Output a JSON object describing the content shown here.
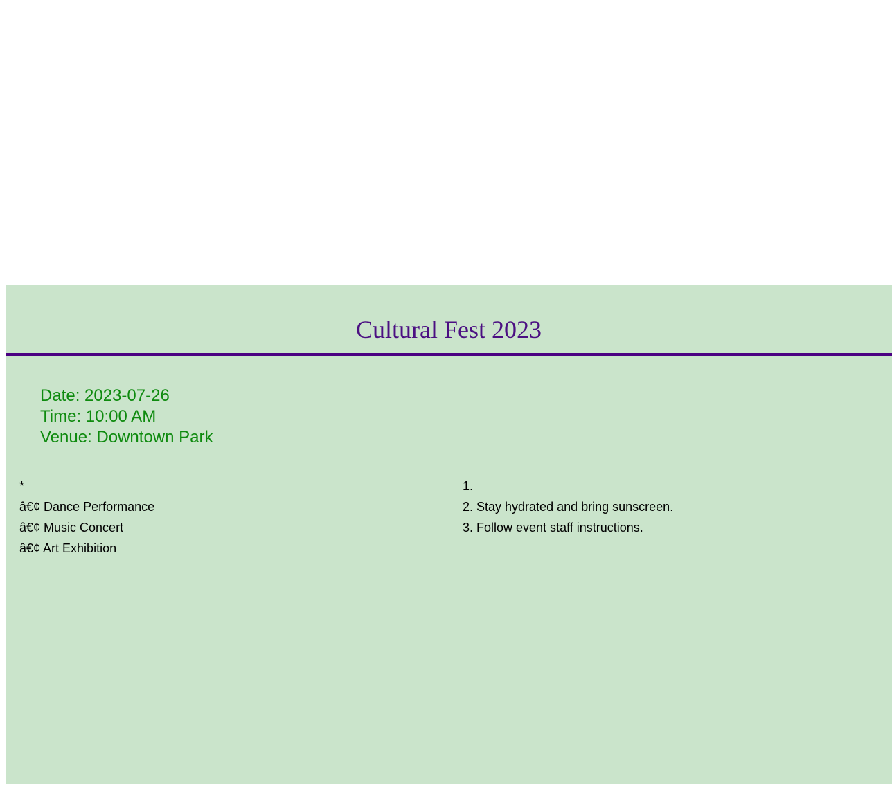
{
  "event": {
    "title": "Cultural Fest 2023",
    "date": "Date: 2023-07-26",
    "time": "Time: 10:00 AM",
    "venue": "Venue: Downtown Park"
  },
  "activities": {
    "marker": "*",
    "items": [
      "â€¢ Dance Performance",
      "â€¢ Music Concert",
      "â€¢ Art Exhibition"
    ]
  },
  "guidelines": {
    "items": [
      "1.",
      "2. Stay hydrated and bring sunscreen.",
      "3. Follow event staff instructions."
    ]
  },
  "colors": {
    "panel_background": "#cae4cb",
    "title": "#4b0f82",
    "rule": "#4b0082",
    "info_text": "#0e8a0e"
  }
}
